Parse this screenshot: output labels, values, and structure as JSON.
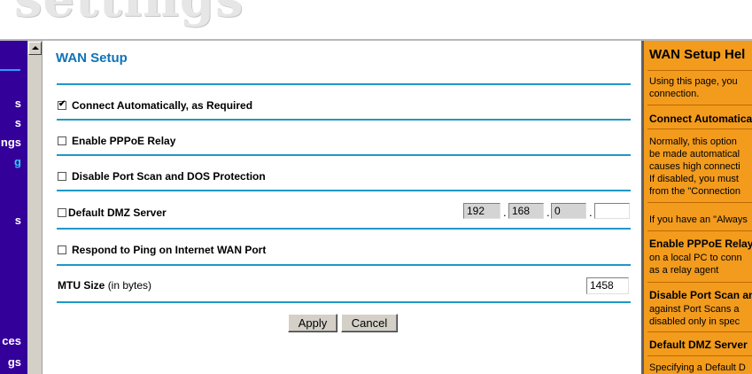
{
  "banner": {
    "word": "settings"
  },
  "leftnav": {
    "items": [
      "s",
      "s",
      "ngs",
      "g",
      "s",
      "ces",
      "gs"
    ]
  },
  "main": {
    "title": "WAN Setup",
    "connect_auto": {
      "label": "Connect Automatically, as Required",
      "checked": true
    },
    "pppoe_relay": {
      "label": "Enable PPPoE Relay",
      "checked": false
    },
    "disable_portscan": {
      "label": "Disable Port Scan and DOS Protection",
      "checked": false
    },
    "dmz": {
      "label": "Default DMZ Server",
      "checked": false,
      "ip": [
        "192",
        "168",
        "0",
        ""
      ],
      "separator": "."
    },
    "respond_ping": {
      "label": "Respond to Ping on Internet WAN Port",
      "checked": false
    },
    "mtu": {
      "label": "MTU Size",
      "unit": "(in bytes)",
      "value": "1458"
    },
    "apply_label": "Apply",
    "cancel_label": "Cancel"
  },
  "help": {
    "title": "WAN Setup Hel",
    "intro": [
      "Using this page, you",
      "connection."
    ],
    "connect_head": "Connect Automatical",
    "connect_text": [
      "Normally, this option",
      "be made automatical",
      "causes high connecti",
      "If disabled, you must",
      "from the \"Connection"
    ],
    "always_text": "If you have an \"Always",
    "pppoe_head": "Enable PPPoE Relay",
    "pppoe_text": [
      "on a local PC to conn",
      "as a relay agent"
    ],
    "portscan_head": "Disable Port Scan an",
    "portscan_text": [
      "against Port Scans a",
      "disabled only in spec"
    ],
    "dmz_head": "Default DMZ Server",
    "dmz_text": "Specifying a Default D"
  },
  "colors": {
    "nav_bg": "#330099",
    "accent_blue": "#0e73b8",
    "rule_blue": "#1f98c7",
    "help_bg": "#f29b1d"
  }
}
